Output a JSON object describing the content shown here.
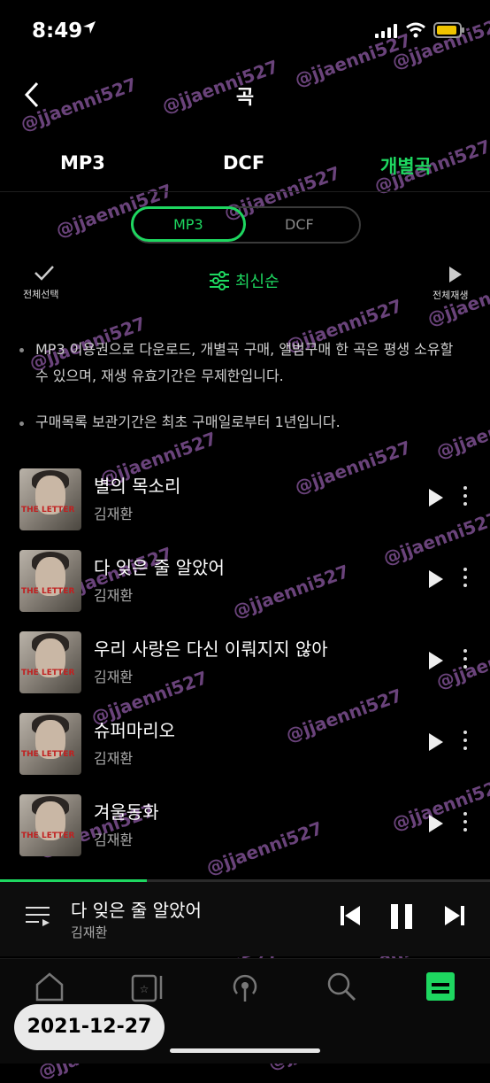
{
  "status_bar": {
    "time": "8:49"
  },
  "header": {
    "title": "곡"
  },
  "tabs": [
    {
      "label": "MP3",
      "active": false
    },
    {
      "label": "DCF",
      "active": false
    },
    {
      "label": "개별곡",
      "active": true
    }
  ],
  "segment": {
    "options": [
      "MP3",
      "DCF"
    ],
    "selected": "MP3"
  },
  "toolbar": {
    "select_all": "전체선택",
    "sort": "최신순",
    "play_all": "전체재생"
  },
  "notes": [
    "MP3 이용권으로 다운로드, 개별곡 구매, 앨범구매 한 곡은 평생 소유할 수 있으며, 재생 유효기간은 무제한입니다.",
    "구매목록 보관기간은 최초 구매일로부터 1년입니다."
  ],
  "songs": [
    {
      "title": "별의 목소리",
      "artist": "김재환"
    },
    {
      "title": "다 잊은 줄 알았어",
      "artist": "김재환"
    },
    {
      "title": "우리 사랑은 다신 이뤄지지 않아",
      "artist": "김재환"
    },
    {
      "title": "슈퍼마리오",
      "artist": "김재환"
    },
    {
      "title": "겨울동화",
      "artist": "김재환"
    }
  ],
  "album_art_text": "THE LETTER",
  "now_playing": {
    "title": "다 잊은 줄 알았어",
    "artist": "김재환",
    "progress": 0.3
  },
  "date_badge": "2021-12-27",
  "watermark": "@jjaenni527",
  "colors": {
    "accent": "#1ed760",
    "background": "#000000",
    "watermark": "#c27ae0"
  }
}
